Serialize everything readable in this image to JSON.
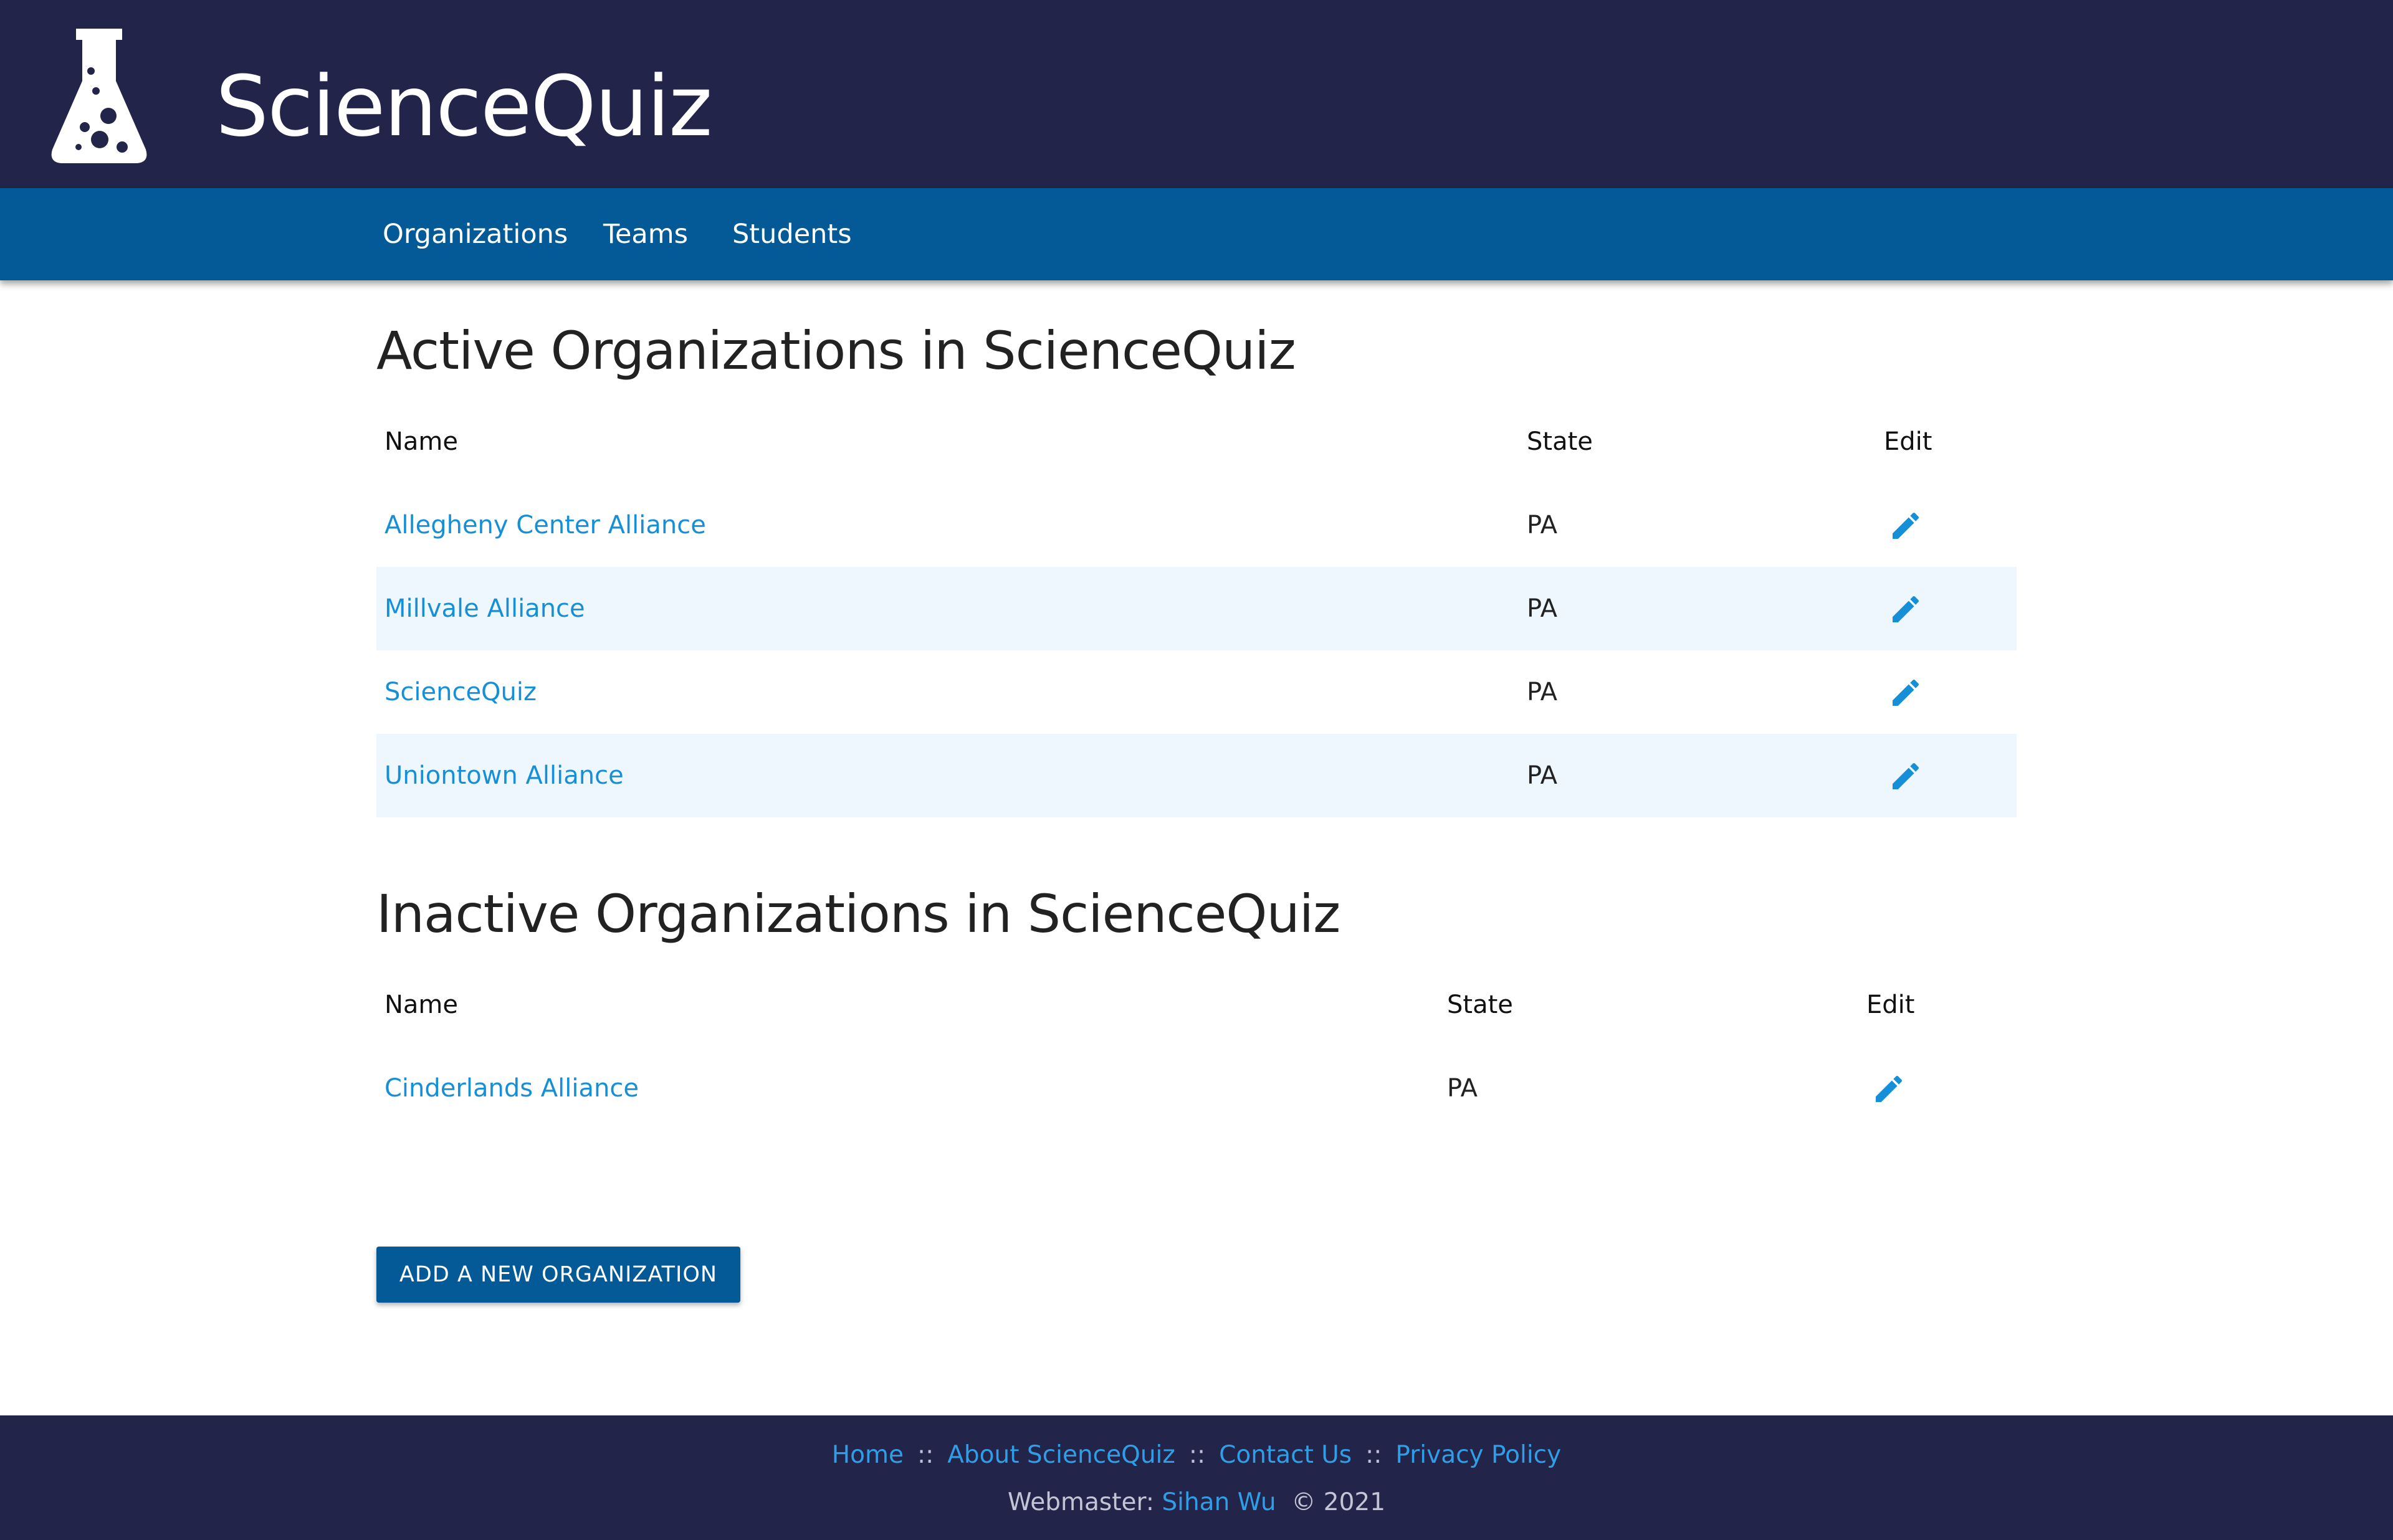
{
  "app": {
    "brand": "ScienceQuiz",
    "logo_icon": "flask-icon"
  },
  "nav": {
    "items": [
      {
        "label": "Organizations"
      },
      {
        "label": "Teams"
      },
      {
        "label": "Students"
      }
    ]
  },
  "active": {
    "title": "Active Organizations in ScienceQuiz",
    "columns": {
      "name": "Name",
      "state": "State",
      "edit": "Edit"
    },
    "rows": [
      {
        "name": "Allegheny Center Alliance",
        "state": "PA",
        "edit_icon": "pencil-icon"
      },
      {
        "name": "Millvale Alliance",
        "state": "PA",
        "edit_icon": "pencil-icon"
      },
      {
        "name": "ScienceQuiz",
        "state": "PA",
        "edit_icon": "pencil-icon"
      },
      {
        "name": "Uniontown Alliance",
        "state": "PA",
        "edit_icon": "pencil-icon"
      }
    ]
  },
  "inactive": {
    "title": "Inactive Organizations in ScienceQuiz",
    "columns": {
      "name": "Name",
      "state": "State",
      "edit": "Edit"
    },
    "rows": [
      {
        "name": "Cinderlands Alliance",
        "state": "PA",
        "edit_icon": "pencil-icon"
      }
    ]
  },
  "actions": {
    "add_label": "ADD A NEW ORGANIZATION"
  },
  "footer": {
    "links": [
      {
        "label": "Home"
      },
      {
        "label": "About ScienceQuiz"
      },
      {
        "label": "Contact Us"
      },
      {
        "label": "Privacy Policy"
      }
    ],
    "separator": "::",
    "webmaster_label": "Webmaster:",
    "webmaster_name": "Sihan Wu",
    "copyright": "© 2021"
  },
  "colors": {
    "header_bg": "#23244a",
    "navbar_bg": "#035a96",
    "link": "#1590d8",
    "stripe": "#eef7fd"
  }
}
